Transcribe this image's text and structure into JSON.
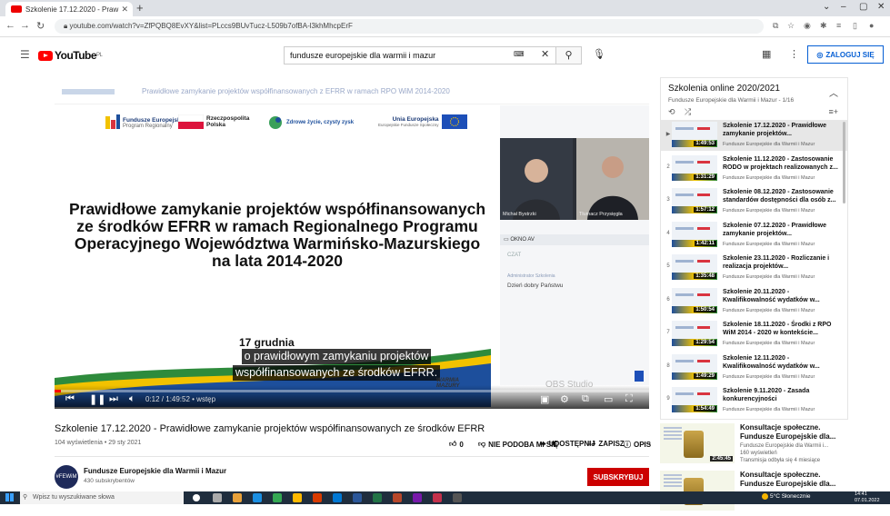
{
  "browser": {
    "tab_title": "Szkolenie 17.12.2020 - Praw",
    "url": "youtube.com/watch?v=ZfPQBQ8EvXY&list=PLccs9BUvTucz-L509b7ofBA-l3khMhcpErF",
    "window_controls": [
      "⌄",
      "–",
      "▢",
      "✕"
    ]
  },
  "header": {
    "logo_text": "YouTube",
    "logo_region": "PL",
    "search_value": "fundusze europejskie dla warmii i mazur",
    "login_label": "ZALOGUJ SIĘ"
  },
  "video": {
    "top_strip_title": "Prawidłowe zamykanie projektów współfinansowanych z EFRR w ramach RPO WiM 2014-2020",
    "logos": {
      "fe_title": "Fundusze Europejskie",
      "fe_sub": "Program Regionalny",
      "rp": "Rzeczpospolita Polska",
      "zdrowe": "Zdrowe życie, czysty zysk",
      "ue_title": "Unia Europejska",
      "ue_sub": "Europejskie Fundusze Społeczny"
    },
    "headline": "Prawidłowe zamykanie projektów współfinansowanych ze środków EFRR w ramach Regionalnego Programu Operacyjnego Województwa Warmińsko-Mazurskiego na lata 2014-2020",
    "date_text": "17 grudnia",
    "caption_line1": "o prawidłowym zamykaniu projektów",
    "caption_line2": "współfinansowanych ze środków EFRR.",
    "cam1_name": "Michał Bystrzki",
    "cam2_name": "Tłumacz Przysięgła",
    "chat_bar": "OKNO AV",
    "chat_header": "CZAT",
    "chat_sub": "Administrator Szkolenia",
    "chat_message": "Dzień dobry Państwu",
    "wm_logo": "WARMIA MAZURY",
    "watermark": "OBS Studio",
    "time": "0:12 / 1:49:52 • wstęp",
    "progress": 0.01
  },
  "below": {
    "title": "Szkolenie 17.12.2020 - Prawidłowe zamykanie projektów współfinansowanych ze środków EFRR",
    "views": "104 wyświetlenia • 29 sty 2021",
    "likes": "0",
    "dislike": "NIE PODOBA MI SIĘ",
    "share": "UDOSTĘPNIJ",
    "save": "ZAPISZ",
    "description": "OPIS",
    "channel": "Fundusze Europejskie dla Warmii i Mazur",
    "subs": "430 subskrybentów",
    "avatar_text": "#FEWiM",
    "subscribe": "SUBSKRYBUJ"
  },
  "playlist": {
    "title": "Szkolenia online 2020/2021",
    "subtitle": "Fundusze Europejskie dla Warmii i Mazur - 1/16",
    "items": [
      {
        "index": "▶",
        "title": "Szkolenie 17.12.2020 - Prawidłowe zamykanie projektów...",
        "channel": "Fundusze Europejskie dla Warmii i Mazur",
        "duration": "1:49:53"
      },
      {
        "index": "2",
        "title": "Szkolenie 11.12.2020 - Zastosowanie RODO w projektach realizowanych z...",
        "channel": "Fundusze Europejskie dla Warmii i Mazur",
        "duration": "1:31:29"
      },
      {
        "index": "3",
        "title": "Szkolenie 08.12.2020 - Zastosowanie standardów dostępności dla osób z...",
        "channel": "Fundusze Europejskie dla Warmii i Mazur",
        "duration": "1:57:12"
      },
      {
        "index": "4",
        "title": "Szkolenie 07.12.2020 - Prawidłowe zamykanie projektów...",
        "channel": "Fundusze Europejskie dla Warmii i Mazur",
        "duration": "1:42:11"
      },
      {
        "index": "5",
        "title": "Szkolenie 23.11.2020 - Rozliczanie i realizacja projektów...",
        "channel": "Fundusze Europejskie dla Warmii i Mazur",
        "duration": "1:35:48"
      },
      {
        "index": "6",
        "title": "Szkolenie 20.11.2020 - Kwalifikowalność wydatków w...",
        "channel": "Fundusze Europejskie dla Warmii i Mazur",
        "duration": "1:50:54"
      },
      {
        "index": "7",
        "title": "Szkolenie 18.11.2020 - Środki z RPO WiM 2014 - 2020 w kontekście...",
        "channel": "Fundusze Europejskie dla Warmii i Mazur",
        "duration": "1:29:54"
      },
      {
        "index": "8",
        "title": "Szkolenie 12.11.2020 - Kwalifikowalność wydatków w...",
        "channel": "Fundusze Europejskie dla Warmii i Mazur",
        "duration": "1:49:29"
      },
      {
        "index": "9",
        "title": "Szkolenie 9.11.2020 - Zasada konkurencyjności",
        "channel": "Fundusze Europejskie dla Warmii i Mazur",
        "duration": "1:54:49"
      }
    ]
  },
  "recommended": [
    {
      "title": "Konsultacje społeczne. Fundusze Europejskie dla...",
      "channel": "Fundusze Europejskie dla Warmii i...",
      "views": "160 wyświetleń",
      "time": "Transmisja odbyła się 4 miesiące",
      "duration": "2:45:45"
    },
    {
      "title": "Konsultacje społeczne. Fundusze Europejskie dla...",
      "channel": "",
      "views": "",
      "time": "",
      "duration": ""
    }
  ],
  "taskbar": {
    "search_placeholder": "Wpisz tu wyszukiwane słowa",
    "weather": "5°C Słonecznie",
    "clock_time": "14:41",
    "clock_date": "07.01.2022"
  },
  "colors": {
    "accent": "#065fd4",
    "youtube_red": "#ff0000",
    "subscribe": "#cc0000"
  }
}
